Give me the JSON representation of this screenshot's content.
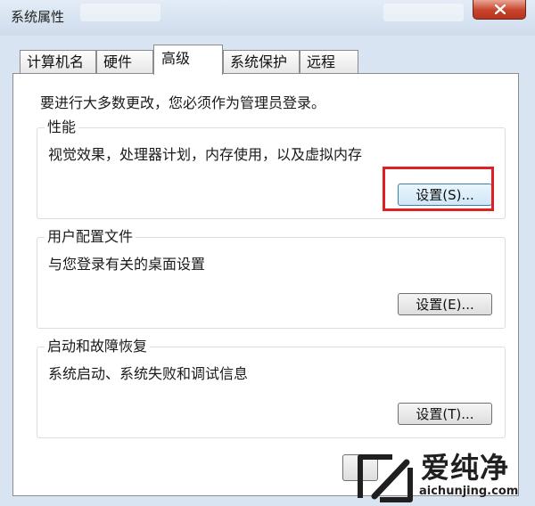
{
  "window": {
    "title": "系统属性"
  },
  "tabs": [
    {
      "label": "计算机名"
    },
    {
      "label": "硬件"
    },
    {
      "label": "高级",
      "active": true
    },
    {
      "label": "系统保护"
    },
    {
      "label": "远程"
    }
  ],
  "notice": "要进行大多数更改，您必须作为管理员登录。",
  "groups": {
    "performance": {
      "title": "性能",
      "description": "视觉效果，处理器计划，内存使用，以及虚拟内存",
      "button": "设置(S)..."
    },
    "user_profiles": {
      "title": "用户配置文件",
      "description": "与您登录有关的桌面设置",
      "button": "设置(E)..."
    },
    "startup_recovery": {
      "title": "启动和故障恢复",
      "description": "系统启动、系统失败和调试信息",
      "button": "设置(T)..."
    }
  },
  "watermark": {
    "brand": "爱纯净",
    "url": "aichunjing.com"
  },
  "colors": {
    "highlight": "#e02020",
    "close": "#c7432a",
    "titlebar": "#d8e4f1"
  }
}
